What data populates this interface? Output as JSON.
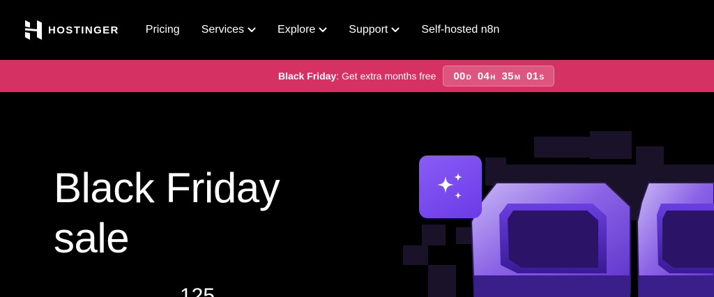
{
  "brand": {
    "name": "HOSTINGER",
    "logo_icon": "hostinger-h-logo"
  },
  "nav": {
    "items": [
      {
        "label": "Pricing",
        "has_dropdown": false
      },
      {
        "label": "Services",
        "has_dropdown": true
      },
      {
        "label": "Explore",
        "has_dropdown": true
      },
      {
        "label": "Support",
        "has_dropdown": true
      },
      {
        "label": "Self-hosted n8n",
        "has_dropdown": false
      }
    ]
  },
  "promo": {
    "highlight": "Black Friday",
    "text": ": Get extra months free",
    "countdown": [
      {
        "value": "00",
        "unit": "D"
      },
      {
        "value": "04",
        "unit": "H"
      },
      {
        "value": "35",
        "unit": "M"
      },
      {
        "value": "01",
        "unit": "S"
      }
    ]
  },
  "hero": {
    "title_line1": "Black Friday",
    "title_line2": "sale",
    "subtitle_partial": "125"
  },
  "colors": {
    "background": "#000000",
    "promo_bar": "#d63163",
    "accent_purple": "#7b4ff0",
    "art_dark_purple": "#1a1228",
    "text": "#ffffff"
  }
}
